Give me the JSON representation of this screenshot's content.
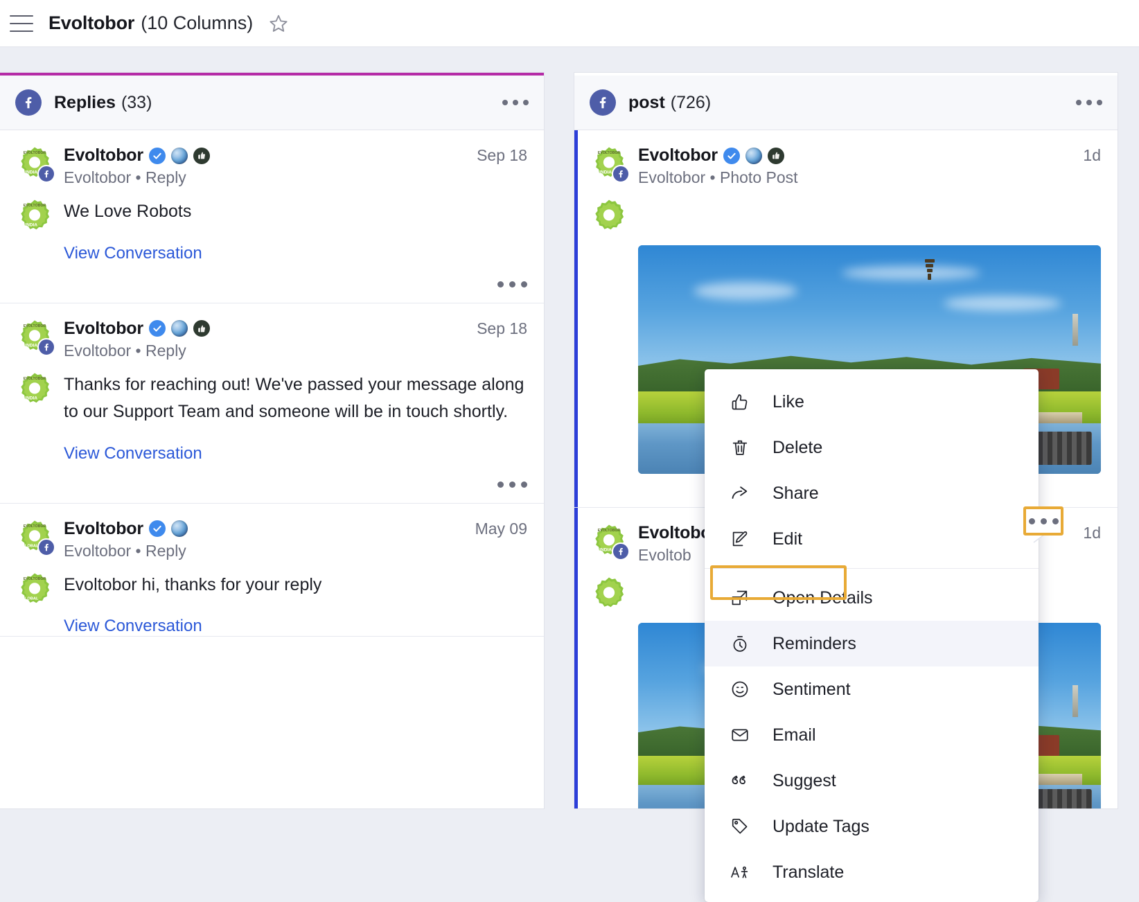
{
  "topbar": {
    "menu_icon": "hamburger-icon",
    "title": "Evoltobor",
    "subtitle": "(10 Columns)",
    "favorite_icon": "star-icon"
  },
  "colors": {
    "accent_bar": "#b52ba6",
    "selected_post": "#2c3ed8",
    "highlight_box": "#e8aa36",
    "link": "#2b58d8",
    "facebook": "#4e5da8",
    "verified": "#3f8aed"
  },
  "columns": [
    {
      "network_icon": "facebook-icon",
      "title": "Replies",
      "count": "(33)",
      "overflow_icon": "more-options-icon",
      "accent": true,
      "items": [
        {
          "avatar_icon": "evoltobor-gear-avatar",
          "avatar_label": "INDIA",
          "author": "Evoltobor",
          "badges": [
            "verified-badge-icon",
            "globe-badge-icon",
            "thumb-badge-icon"
          ],
          "meta": "Evoltobor • Reply",
          "timestamp": "Sep 18",
          "text": "We Love Robots",
          "link": "View Conversation",
          "row_overflow_icon": "more-options-icon"
        },
        {
          "avatar_icon": "evoltobor-gear-avatar",
          "avatar_label": "INDIA",
          "author": "Evoltobor",
          "badges": [
            "verified-badge-icon",
            "globe-badge-icon",
            "thumb-badge-icon"
          ],
          "meta": "Evoltobor • Reply",
          "timestamp": "Sep 18",
          "text": "Thanks for reaching out! We've passed your message along to our Support Team and someone will be in touch shortly.",
          "link": "View Conversation",
          "row_overflow_icon": "more-options-icon"
        },
        {
          "avatar_icon": "evoltobor-gear-avatar",
          "avatar_label": "GLOBAL",
          "author": "Evoltobor",
          "badges": [
            "verified-badge-icon",
            "globe-badge-icon"
          ],
          "meta": "Evoltobor • Reply",
          "timestamp": "May 09",
          "text": "Evoltobor hi, thanks for your reply",
          "link": "View Conversation",
          "row_overflow_icon": "more-options-icon"
        }
      ]
    },
    {
      "network_icon": "facebook-icon",
      "title": "post",
      "count": "(726)",
      "overflow_icon": "more-options-icon",
      "accent": false,
      "items": [
        {
          "avatar_icon": "evoltobor-gear-avatar",
          "avatar_label": "INDIA",
          "author": "Evoltobor",
          "badges": [
            "verified-badge-icon",
            "globe-badge-icon",
            "thumb-badge-icon"
          ],
          "meta": "Evoltobor • Photo Post",
          "timestamp": "1d",
          "media_icon": "photo-attachment",
          "selected": true,
          "row_overflow_icon": "more-options-icon"
        },
        {
          "avatar_icon": "evoltobor-gear-avatar",
          "avatar_label": "INDIA",
          "author": "Evoltobor",
          "meta": "Evoltob",
          "timestamp": "1d",
          "media_icon": "photo-attachment",
          "selected": true
        }
      ]
    }
  ],
  "context_menu": {
    "groups": [
      [
        {
          "icon": "thumbs-up-icon",
          "label": "Like"
        },
        {
          "icon": "trash-icon",
          "label": "Delete"
        },
        {
          "icon": "share-arrow-icon",
          "label": "Share"
        },
        {
          "icon": "pencil-edit-icon",
          "label": "Edit"
        }
      ],
      [
        {
          "icon": "open-details-icon",
          "label": "Open Details"
        },
        {
          "icon": "stopwatch-icon",
          "label": "Reminders",
          "highlighted": true
        },
        {
          "icon": "smiley-face-icon",
          "label": "Sentiment"
        },
        {
          "icon": "envelope-icon",
          "label": "Email"
        },
        {
          "icon": "quote-icon",
          "label": "Suggest"
        },
        {
          "icon": "tag-icon",
          "label": "Update Tags"
        },
        {
          "icon": "translate-icon",
          "label": "Translate"
        }
      ]
    ]
  }
}
